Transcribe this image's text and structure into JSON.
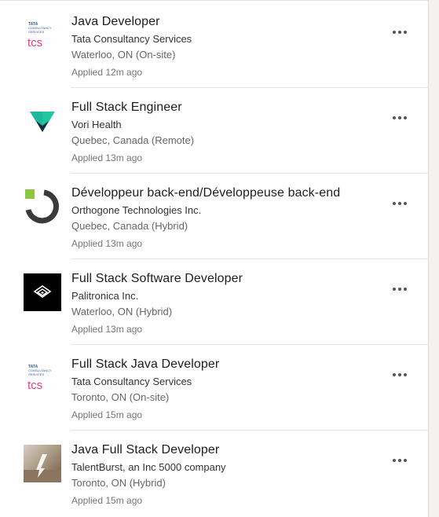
{
  "jobs": [
    {
      "title": "Java Developer",
      "company": "Tata Consultancy Services",
      "location": "Waterloo, ON (On-site)",
      "applied": "Applied 12m ago",
      "logo": "tcs-logo",
      "logo_text": [
        "TATA",
        "CONSULTANCY",
        "SERVICES",
        "tcs"
      ]
    },
    {
      "title": "Full Stack Engineer",
      "company": "Vori Health",
      "location": "Quebec, Canada (Remote)",
      "applied": "Applied 13m ago",
      "logo": "vori-health-logo"
    },
    {
      "title": "Développeur back-end/Développeuse back-end",
      "company": "Orthogone Technologies Inc.",
      "location": "Quebec, Canada (Hybrid)",
      "applied": "Applied 13m ago",
      "logo": "orthogone-logo"
    },
    {
      "title": "Full Stack Software Developer",
      "company": "Palitronica Inc.",
      "location": "Waterloo, ON (Hybrid)",
      "applied": "Applied 13m ago",
      "logo": "palitronica-logo"
    },
    {
      "title": "Full Stack Java Developer",
      "company": "Tata Consultancy Services",
      "location": "Toronto, ON (On-site)",
      "applied": "Applied 15m ago",
      "logo": "tcs-logo",
      "logo_text": [
        "TATA",
        "CONSULTANCY",
        "SERVICES",
        "tcs"
      ]
    },
    {
      "title": "Java Full Stack Developer",
      "company": "TalentBurst, an Inc 5000 company",
      "location": "Toronto, ON (Hybrid)",
      "applied": "Applied 15m ago",
      "logo": "talentburst-logo"
    }
  ],
  "colors": {
    "tcs_red": "#e0457b",
    "tcs_blue": "#2a5caa",
    "vori_green": "#23c4a0",
    "vori_dark": "#1a2b3c",
    "orthogone_green": "#8dc63f",
    "orthogone_dark": "#3a3a3a"
  },
  "icons": {
    "more": "more-options-icon"
  }
}
